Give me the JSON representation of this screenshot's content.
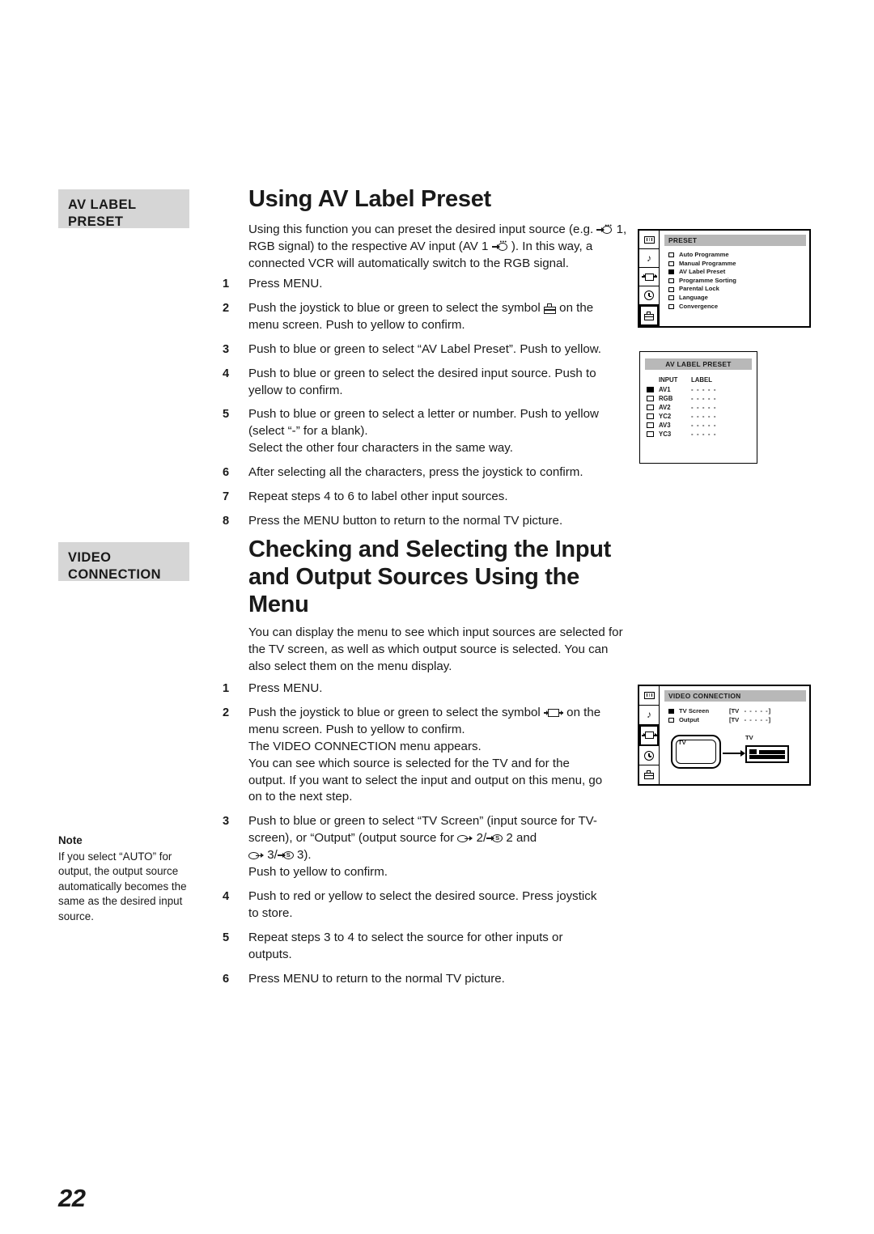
{
  "page": {
    "number": "22"
  },
  "sections": [
    {
      "side_label_line1": "AV LABEL",
      "side_label_line2": "PRESET",
      "title": "Using AV Label Preset",
      "intro": "Using this function you can preset the desired input source (e.g. –○ 1, RGB signal) to the respective AV input (AV 1 –○).  In this way, a connected VCR will automatically switch to the RGB signal.",
      "intro_parts": {
        "p1": "Using this function you can preset the desired input source (e.g.",
        "p2": "1, RGB signal) to the respective AV input (AV 1",
        "p3": ").  In this way, a connected VCR will automatically switch to the RGB signal."
      },
      "steps": [
        {
          "num": "1",
          "text": "Press MENU."
        },
        {
          "num": "2",
          "text_a": "Push the joystick to blue or green to select the symbol",
          "text_b": "on the menu screen.  Push to yellow to confirm."
        },
        {
          "num": "3",
          "text": "Push to blue or green to select “AV Label Preset”.  Push to yellow."
        },
        {
          "num": "4",
          "text": "Push to blue or green to select the desired input source.  Push to yellow to confirm."
        },
        {
          "num": "5",
          "text": "Push to blue or green to select a letter or number.  Push to yellow (select “-” for a blank).\nSelect the other four characters in the same way."
        },
        {
          "num": "6",
          "text": "After selecting all the characters, press the joystick to confirm."
        },
        {
          "num": "7",
          "text": "Repeat steps 4 to 6 to label other input sources."
        },
        {
          "num": "8",
          "text": "Press the MENU button to return to the normal TV picture."
        }
      ]
    },
    {
      "side_label_line1": "VIDEO",
      "side_label_line2": "CONNECTION",
      "title": "Checking and Selecting the Input and Output Sources Using the Menu",
      "intro": "You can display the menu to see which input sources are selected for the TV screen, as well as which output source is selected.  You can also select them on the menu display.",
      "steps": [
        {
          "num": "1",
          "text": "Press MENU."
        },
        {
          "num": "2",
          "text_a": "Push the joystick to blue or green to select the symbol",
          "text_b": "on the menu screen.  Push to yellow to confirm.\nThe VIDEO CONNECTION menu appears.\nYou can see which source is selected for the TV and for the output.  If you want to select the input and output on this menu, go on to the next step."
        },
        {
          "num": "3",
          "text_a": "Push to blue or green to select “TV Screen” (input source for TV-screen), or “Output” (output source for",
          "text_b": "2/",
          "text_c": "2 and",
          "text_d": "3/",
          "text_e": "3).",
          "text_f": "Push to yellow to confirm."
        },
        {
          "num": "4",
          "text": "Push to red or yellow to select the desired source.  Press joystick to store."
        },
        {
          "num": "5",
          "text": "Repeat steps 3 to 4 to select the source for other inputs or outputs."
        },
        {
          "num": "6",
          "text": "Press MENU to return to the normal TV picture."
        }
      ]
    }
  ],
  "note": {
    "title": "Note",
    "text": "If you select “AUTO” for output, the output source automatically becomes the same as the desired input source."
  },
  "osd_preset": {
    "title": "PRESET",
    "rail_icons": [
      "screen-icon",
      "music-note-icon",
      "video-connection-icon",
      "clock-icon",
      "toolbox-icon"
    ],
    "selected_rail_index": 4,
    "items": [
      {
        "label": "Auto Programme",
        "selected": false
      },
      {
        "label": "Manual Programme",
        "selected": false
      },
      {
        "label": "AV Label Preset",
        "selected": true
      },
      {
        "label": "Programme Sorting",
        "selected": false
      },
      {
        "label": "Parental Lock",
        "selected": false
      },
      {
        "label": "Language",
        "selected": false
      },
      {
        "label": "Convergence",
        "selected": false
      }
    ]
  },
  "osd_av_label": {
    "title": "AV LABEL PRESET",
    "columns": [
      "INPUT",
      "LABEL"
    ],
    "rows": [
      {
        "input": "AV1",
        "label": "- - - - -",
        "selected": true
      },
      {
        "input": "RGB",
        "label": "- - - - -",
        "selected": false
      },
      {
        "input": "AV2",
        "label": "- - - - -",
        "selected": false
      },
      {
        "input": "YC2",
        "label": "- - - - -",
        "selected": false
      },
      {
        "input": "AV3",
        "label": "- - - - -",
        "selected": false
      },
      {
        "input": "YC3",
        "label": "- - - - -",
        "selected": false
      }
    ]
  },
  "osd_video_connection": {
    "title": "VIDEO CONNECTION",
    "rail_icons": [
      "screen-icon",
      "music-note-icon",
      "video-connection-icon",
      "clock-icon",
      "toolbox-icon"
    ],
    "selected_rail_index": 2,
    "rows": [
      {
        "name": "TV Screen",
        "value_prefix": "[TV",
        "value_dashes": "- - - - -]",
        "selected": true
      },
      {
        "name": "Output",
        "value_prefix": "[TV",
        "value_dashes": "- - - - -]",
        "selected": false
      }
    ],
    "diagram": {
      "tv_label": "TV",
      "vcr_label": "TV"
    }
  },
  "glyphs": {
    "music_note": "♪",
    "s_letter": "S"
  }
}
